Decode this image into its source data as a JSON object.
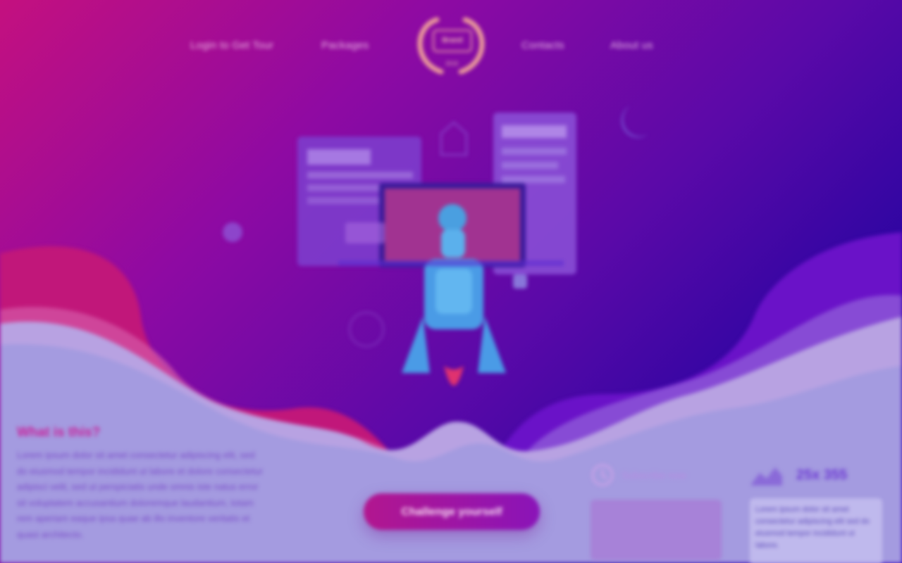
{
  "nav": {
    "login_label": "Login to Get Tour",
    "packages_label": "Packages",
    "contacts_label": "Contacts",
    "about_label": "About us",
    "logo_text": "Brand",
    "logo_subtext": "2019"
  },
  "about": {
    "title": "What is this?",
    "body": "Lorem ipsum dolor sit amet consectetur adipiscing elit, sed do eiusmod tempor incididunt ut labore et dolore consectetur adipisci velit, sed ut perspiciatis unde omnis iste natus error sit voluptatem accusantium doloremque laudantium, totam rem aperiam eaque ipsa quae ab illo inventore veritatis et quasi architecto."
  },
  "cta": {
    "label": "Challenge yourself"
  },
  "feature1": {
    "label": "Subscribe now"
  },
  "feature2": {
    "stat": "25x 355",
    "body": "Lorem ipsum dolor sit amet consectetur adipiscing elit sed do eiusmod tempor incididunt ut labore."
  },
  "colors": {
    "magenta": "#c4107f",
    "violet": "#5a09a8",
    "deep_blue": "#2f05a2",
    "lavender": "#b9a7e6",
    "cta": "#b2168f"
  }
}
